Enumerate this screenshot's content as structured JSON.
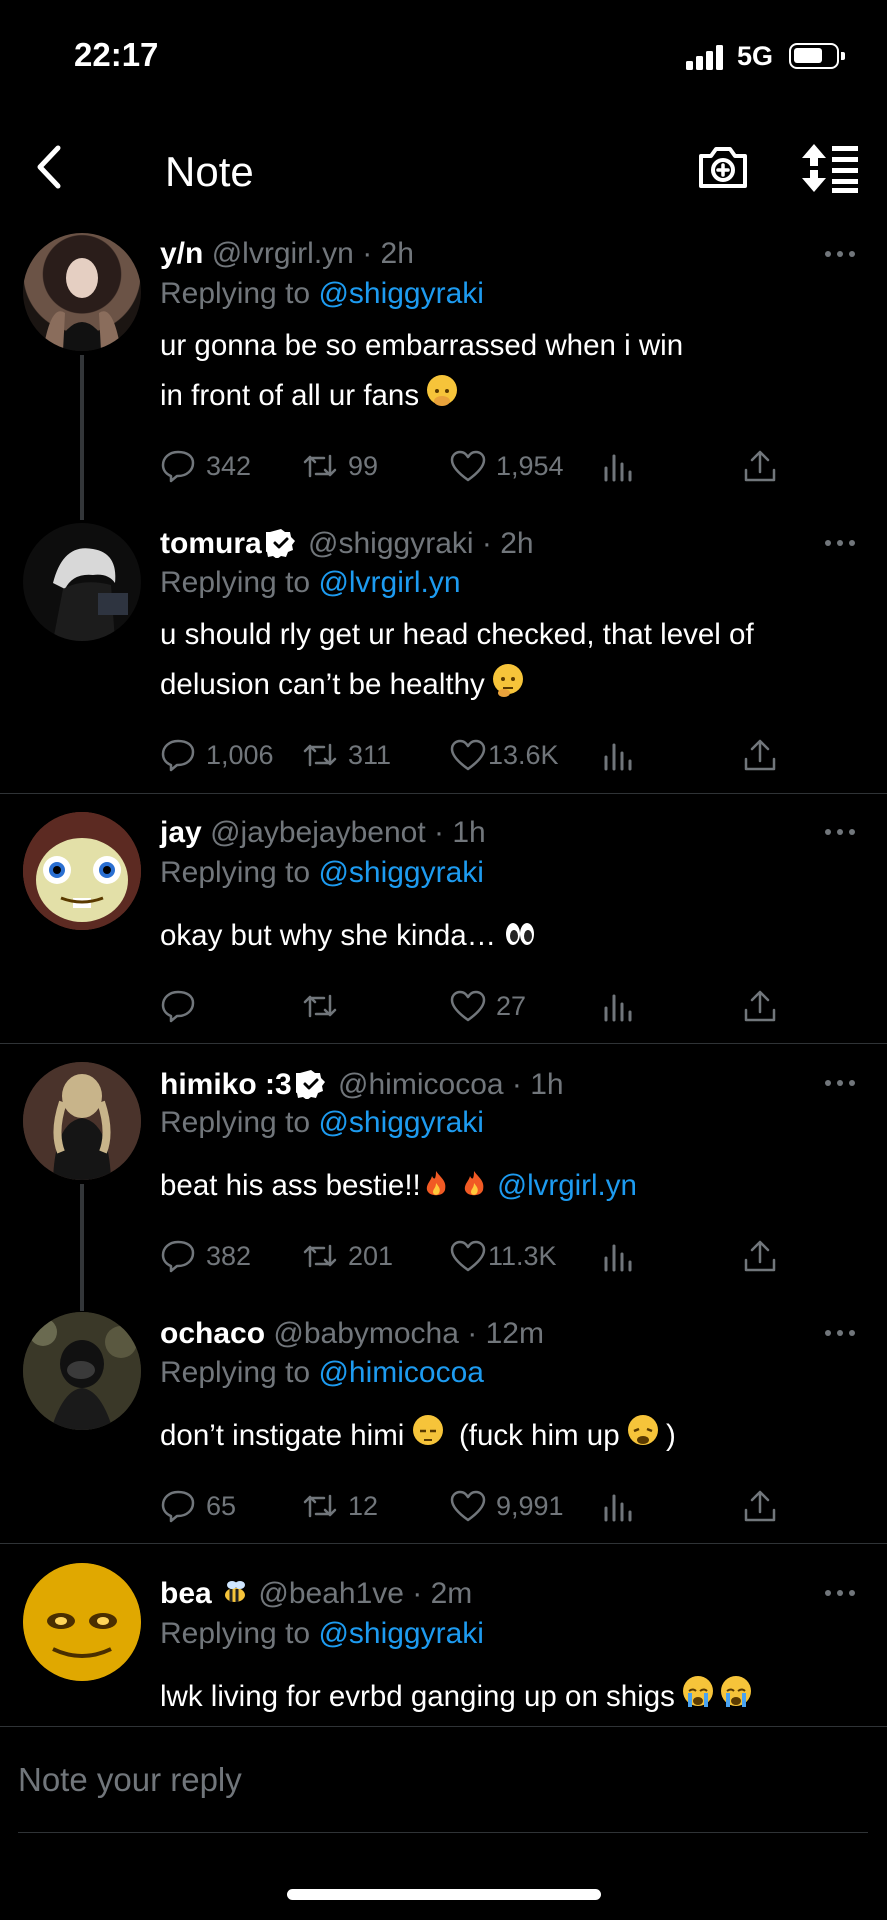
{
  "status": {
    "time": "22:17",
    "network": "5G"
  },
  "header": {
    "title": "Note"
  },
  "tweets": [
    {
      "name": "y/n",
      "handle": "@lvrgirl.yn",
      "time": "· 2h",
      "replying_label": "Replying to",
      "replying_to": "@shiggyraki",
      "text_line1": "ur gonna be so embarrassed when i win",
      "text_line2": "in front of all ur fans",
      "replies": "342",
      "retweets": "99",
      "likes": "1,954"
    },
    {
      "name": "tomura",
      "handle": "@shiggyraki",
      "time": "· 2h",
      "replying_label": "Replying to",
      "replying_to": "@lvrgirl.yn",
      "text_line1": "u should rly get ur head checked, that level of",
      "text_line2": "delusion can’t be healthy",
      "replies": "1,006",
      "retweets": "311",
      "likes": "13.6K"
    },
    {
      "name": "jay",
      "handle": "@jaybejaybenot",
      "time": "· 1h",
      "replying_label": "Replying to",
      "replying_to": "@shiggyraki",
      "text_line1": "okay but why she kinda…",
      "replies": "",
      "retweets": "",
      "likes": "27"
    },
    {
      "name": "himiko :3",
      "handle": "@himicocoa",
      "time": "· 1h",
      "replying_label": "Replying to",
      "replying_to": "@shiggyraki",
      "text_line1": "beat his ass bestie!!",
      "text_mention": "@lvrgirl.yn",
      "replies": "382",
      "retweets": "201",
      "likes": "11.3K"
    },
    {
      "name": "ochaco",
      "handle": "@babymocha",
      "time": "· 12m",
      "replying_label": "Replying to",
      "replying_to": "@himicocoa",
      "text_line1a": "don’t instigate himi",
      "text_line1b": "(fuck him up",
      "text_line1c": ")",
      "replies": "65",
      "retweets": "12",
      "likes": "9,991"
    },
    {
      "name": "bea",
      "handle": "@beah1ve",
      "time": "· 2m",
      "replying_label": "Replying to",
      "replying_to": "@shiggyraki",
      "text_line1": "lwk living for evrbd ganging up on shigs"
    }
  ],
  "reply_bar": {
    "placeholder": "Note your reply"
  },
  "colors": {
    "background": "#000000",
    "text": "#e7e9ea",
    "muted": "#71767b",
    "link": "#1d9bf0",
    "verified": "#ffffff"
  },
  "icons": [
    "back-arrow-icon",
    "camera-plus-icon",
    "sort-icon",
    "more-icon",
    "reply-icon",
    "retweet-icon",
    "like-icon",
    "views-icon",
    "share-icon",
    "verified-icon"
  ]
}
